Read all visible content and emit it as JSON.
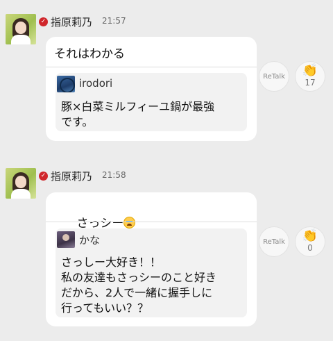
{
  "posts": [
    {
      "author": "指原莉乃",
      "verified_mark": "✓",
      "time": "21:57",
      "message": "それはわかる",
      "has_emoji": false,
      "quote": {
        "user": "irodori",
        "icon": "irodori-avatar-icon",
        "text": "豚×白菜ミルフィーユ鍋が最強\nです。"
      },
      "retalk_label": "ReTalk",
      "clap_icon": "clap-hands-icon",
      "clap_count": "17"
    },
    {
      "author": "指原莉乃",
      "verified_mark": "✓",
      "time": "21:58",
      "message": "さっシー",
      "has_emoji": true,
      "emoji": "crying-face-emoji",
      "quote": {
        "user": "かな",
        "icon": "kana-avatar-icon",
        "text": "さっしー大好き！！\n私の友達もさっシーのこと好き\nだから、2人で一緒に握手しに\n行ってもいい？？"
      },
      "retalk_label": "ReTalk",
      "clap_icon": "clap-hands-icon",
      "clap_count": "0"
    }
  ],
  "colors": {
    "background": "#ececec",
    "bubble": "#ffffff",
    "quote_bg": "#f2f2f2",
    "verified": "#d0262b"
  }
}
